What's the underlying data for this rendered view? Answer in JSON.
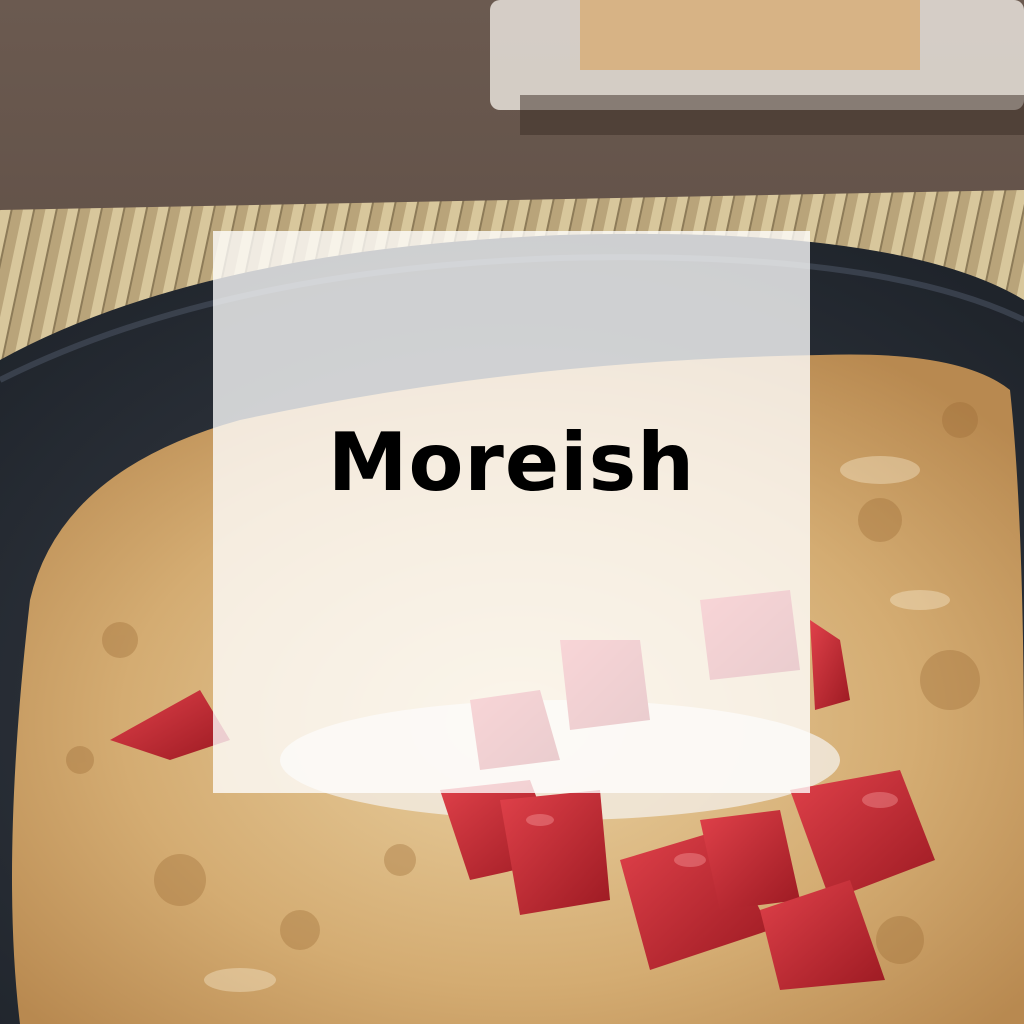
{
  "overlay": {
    "headline": "Moreish"
  },
  "colors": {
    "card_background": "#ffffff",
    "headline_text": "#000000",
    "table_wood": "#5a4a40",
    "bamboo_mat": "#c9b58a",
    "plate": "#2b3038",
    "toast": "#d8b27a",
    "strawberry": "#c0262e"
  }
}
